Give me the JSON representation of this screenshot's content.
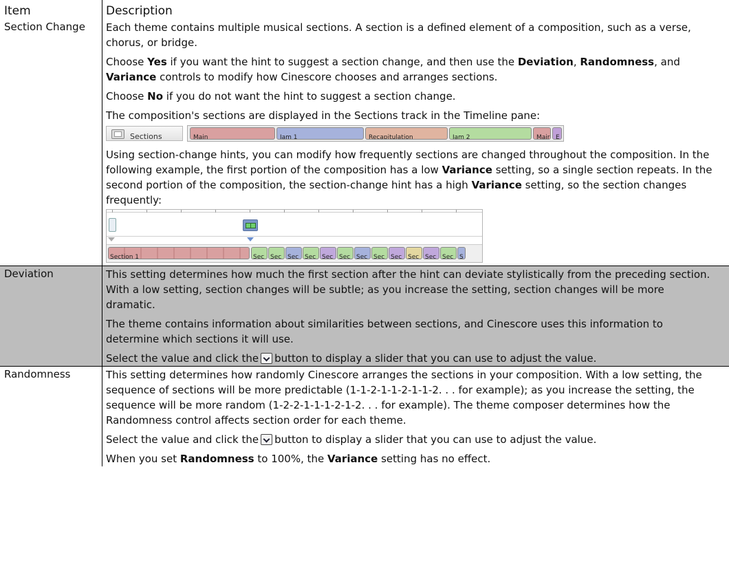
{
  "header": {
    "item": "Item",
    "description": "Description"
  },
  "section_change": {
    "item": "Section Change",
    "p1": "Each theme contains multiple musical sections. A section is a defined element of a composition, such as a verse, chorus, or bridge.",
    "p2": [
      {
        "t": "Choose ",
        "b": false
      },
      {
        "t": "Yes",
        "b": true
      },
      {
        "t": " if you want the hint to suggest a section change, and then use the ",
        "b": false
      },
      {
        "t": "Deviation",
        "b": true
      },
      {
        "t": ", ",
        "b": false
      },
      {
        "t": "Randomness",
        "b": true
      },
      {
        "t": ", and ",
        "b": false
      },
      {
        "t": "Variance",
        "b": true
      },
      {
        "t": " controls to modify how Cinescore chooses and arranges sections.",
        "b": false
      }
    ],
    "p3": [
      {
        "t": "Choose ",
        "b": false
      },
      {
        "t": "No",
        "b": true
      },
      {
        "t": " if you do not want the hint to suggest a section change.",
        "b": false
      }
    ],
    "p4": "The composition's sections are displayed in the Sections track in the Timeline pane:",
    "track_label": "Sections",
    "track_segments": [
      {
        "label": "Main",
        "color": "#d9a0a0"
      },
      {
        "label": "Jam 1",
        "color": "#a6b2dc"
      },
      {
        "label": "Recapitulation",
        "color": "#e0b4a0"
      },
      {
        "label": "Jam 2",
        "color": "#b4dca0"
      },
      {
        "label": "Mair",
        "color": "#d9a0a0"
      },
      {
        "label": "E",
        "color": "#c0a0d8"
      }
    ],
    "p5": [
      {
        "t": "Using section-change hints, you can modify how frequently sections are changed throughout the composition. In the following example, the first portion of the composition has a low ",
        "b": false
      },
      {
        "t": "Variance",
        "b": true
      },
      {
        "t": " setting, so a single section repeats. In the second portion of the composition, the section-change hint has a high ",
        "b": false
      },
      {
        "t": "Variance",
        "b": true
      },
      {
        "t": " setting, so the section changes frequently:",
        "b": false
      }
    ],
    "timeline_first_label": "Section 1",
    "timeline_segments": [
      {
        "label": "Sec",
        "color": "#b4dca0"
      },
      {
        "label": "Sec",
        "color": "#b4dca0"
      },
      {
        "label": "Sec",
        "color": "#a6b2dc"
      },
      {
        "label": "Sec",
        "color": "#b4dca0"
      },
      {
        "label": "Sec",
        "color": "#c0a8dc"
      },
      {
        "label": "Sec",
        "color": "#b4dca0"
      },
      {
        "label": "Sec",
        "color": "#a6b2dc"
      },
      {
        "label": "Sec",
        "color": "#b4dca0"
      },
      {
        "label": "Sec",
        "color": "#c0a8dc"
      },
      {
        "label": "Sec",
        "color": "#e4d8a0"
      },
      {
        "label": "Sec",
        "color": "#c0a8dc"
      },
      {
        "label": "Sec",
        "color": "#b4dca0"
      },
      {
        "label": "S",
        "color": "#a6b2dc"
      }
    ]
  },
  "deviation": {
    "item": "Deviation",
    "p1": "This setting determines how much the first section after the hint can deviate stylistically from the preceding section. With a low setting, section changes will be subtle; as you increase the setting, section changes will be more dramatic.",
    "p2": "The theme contains information about similarities between sections, and Cinescore uses this information to determine which sections it will use.",
    "p3_before": "Select the value and click the",
    "p3_after": "button to display a slider that you can use to adjust the value."
  },
  "randomness": {
    "item": "Randomness",
    "p1": "This setting determines how randomly Cinescore arranges the sections in your composition. With a low setting, the sequence of sections will be more predictable (1-1-2-1-1-2-1-1-2. . . for example); as you increase the setting, the sequence will be more random (1-2-2-1-1-1-2-1-2. . . for example). The theme composer determines how the Randomness control affects section order for each theme.",
    "p2_before": "Select the value and click the",
    "p2_after": "button to display a slider that you can use to adjust the value.",
    "p3": [
      {
        "t": "When you set ",
        "b": false
      },
      {
        "t": "Randomness",
        "b": true
      },
      {
        "t": " to 100%, the ",
        "b": false
      },
      {
        "t": "Variance",
        "b": true
      },
      {
        "t": " setting has no effect.",
        "b": false
      }
    ]
  },
  "icons": {
    "dropdown_button": "chevron-down-button-icon",
    "sections": "sections-track-icon",
    "hint": "section-change-hint-icon"
  }
}
